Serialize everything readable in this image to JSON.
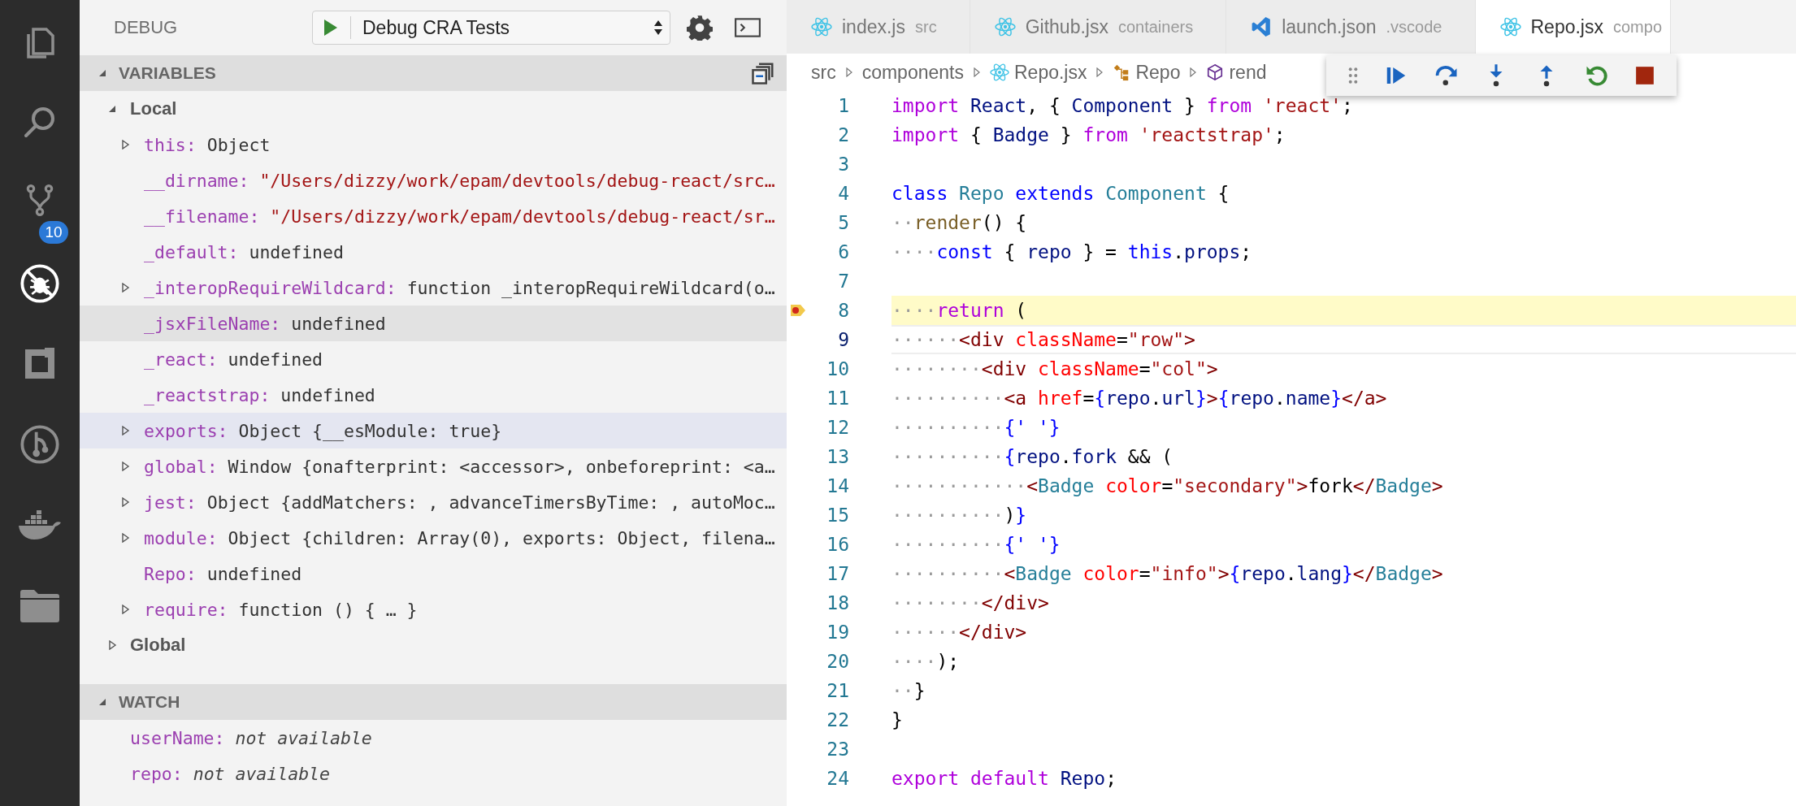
{
  "activity_bar": {
    "items": [
      {
        "kind": "files",
        "selected": false
      },
      {
        "kind": "search",
        "selected": false
      },
      {
        "kind": "source-control",
        "selected": false,
        "badge": "10"
      },
      {
        "kind": "debug",
        "selected": true
      },
      {
        "kind": "extensions",
        "selected": false
      },
      {
        "kind": "branch",
        "selected": false
      },
      {
        "kind": "docker",
        "selected": false
      },
      {
        "kind": "folder",
        "selected": false
      }
    ]
  },
  "debug_header": {
    "title": "DEBUG",
    "configuration": "Debug CRA Tests"
  },
  "variables": {
    "title": "VARIABLES",
    "expanded": true,
    "scopes": [
      {
        "label": "Local",
        "expanded": true,
        "children": [
          {
            "name": "this:",
            "value": "Object",
            "expandable": true,
            "kind": "plain",
            "selected": false,
            "hover": false
          },
          {
            "name": "__dirname:",
            "value": "\"/Users/dizzy/work/epam/devtools/debug-react/src…",
            "expandable": false,
            "kind": "string",
            "selected": false,
            "hover": false
          },
          {
            "name": "__filename:",
            "value": "\"/Users/dizzy/work/epam/devtools/debug-react/sr…",
            "expandable": false,
            "kind": "string",
            "selected": false,
            "hover": false
          },
          {
            "name": "_default:",
            "value": "undefined",
            "expandable": false,
            "kind": "plain",
            "selected": false,
            "hover": false
          },
          {
            "name": "_interopRequireWildcard:",
            "value": "function _interopRequireWildcard(o…",
            "expandable": true,
            "kind": "plain",
            "selected": false,
            "hover": false
          },
          {
            "name": "_jsxFileName:",
            "value": "undefined",
            "expandable": false,
            "kind": "plain",
            "selected": false,
            "hover": true
          },
          {
            "name": "_react:",
            "value": "undefined",
            "expandable": false,
            "kind": "plain",
            "selected": false,
            "hover": false
          },
          {
            "name": "_reactstrap:",
            "value": "undefined",
            "expandable": false,
            "kind": "plain",
            "selected": false,
            "hover": false
          },
          {
            "name": "exports:",
            "value": "Object {__esModule: true}",
            "expandable": true,
            "kind": "plain",
            "selected": true,
            "hover": false
          },
          {
            "name": "global:",
            "value": "Window {onafterprint: <accessor>, onbeforeprint: <a…",
            "expandable": true,
            "kind": "plain",
            "selected": false,
            "hover": false
          },
          {
            "name": "jest:",
            "value": "Object {addMatchers: , advanceTimersByTime: , autoMoc…",
            "expandable": true,
            "kind": "plain",
            "selected": false,
            "hover": false
          },
          {
            "name": "module:",
            "value": "Object {children: Array(0), exports: Object, filena…",
            "expandable": true,
            "kind": "plain",
            "selected": false,
            "hover": false
          },
          {
            "name": "Repo:",
            "value": "undefined",
            "expandable": false,
            "kind": "plain",
            "selected": false,
            "hover": false
          },
          {
            "name": "require:",
            "value": "function () { … }",
            "expandable": true,
            "kind": "plain",
            "selected": false,
            "hover": false
          }
        ]
      },
      {
        "label": "Global",
        "expanded": false
      }
    ]
  },
  "watch": {
    "title": "WATCH",
    "expanded": true,
    "items": [
      {
        "name": "userName:",
        "value": "not available"
      },
      {
        "name": "repo:",
        "value": "not available"
      }
    ]
  },
  "tabs": [
    {
      "label": "index.js",
      "description": "src",
      "kind": "react",
      "selected": false
    },
    {
      "label": "Github.jsx",
      "description": "containers",
      "kind": "react",
      "selected": false
    },
    {
      "label": "launch.json",
      "description": ".vscode",
      "kind": "vscode",
      "selected": false
    },
    {
      "label": "Repo.jsx",
      "description": "compo",
      "kind": "react",
      "selected": true
    }
  ],
  "breadcrumb": [
    {
      "label": "src",
      "kind": "folder"
    },
    {
      "label": "components",
      "kind": "folder"
    },
    {
      "label": "Repo.jsx",
      "kind": "react"
    },
    {
      "label": "Repo",
      "kind": "class"
    },
    {
      "label": "rend",
      "kind": "method"
    }
  ],
  "debug_toolbar": {
    "buttons": [
      {
        "kind": "grip"
      },
      {
        "kind": "continue"
      },
      {
        "kind": "step-over"
      },
      {
        "kind": "step-into"
      },
      {
        "kind": "step-out"
      },
      {
        "kind": "restart"
      },
      {
        "kind": "stop"
      }
    ]
  },
  "editor": {
    "lines": [
      {
        "number": "1",
        "paused": false,
        "cursor": false,
        "tokens": [
          {
            "kind": "kw",
            "text": "import"
          },
          {
            "kind": "var",
            "text": " React"
          },
          {
            "kind": "txt",
            "text": ", { "
          },
          {
            "kind": "var",
            "text": "Component"
          },
          {
            "kind": "txt",
            "text": " } "
          },
          {
            "kind": "kw",
            "text": "from"
          },
          {
            "kind": "str",
            "text": " 'react'"
          },
          {
            "kind": "txt",
            "text": ";"
          }
        ]
      },
      {
        "number": "2",
        "paused": false,
        "cursor": false,
        "tokens": [
          {
            "kind": "kw",
            "text": "import"
          },
          {
            "kind": "txt",
            "text": " { "
          },
          {
            "kind": "var",
            "text": "Badge"
          },
          {
            "kind": "txt",
            "text": " } "
          },
          {
            "kind": "kw",
            "text": "from"
          },
          {
            "kind": "str",
            "text": " 'reactstrap'"
          },
          {
            "kind": "txt",
            "text": ";"
          }
        ]
      },
      {
        "number": "3",
        "paused": false,
        "cursor": false
      },
      {
        "number": "4",
        "paused": false,
        "cursor": false,
        "tokens": [
          {
            "kind": "stor",
            "text": "class"
          },
          {
            "kind": "type",
            "text": " Repo"
          },
          {
            "kind": "stor",
            "text": " extends"
          },
          {
            "kind": "type",
            "text": " Component"
          },
          {
            "kind": "txt",
            "text": " {"
          }
        ]
      },
      {
        "number": "5",
        "paused": false,
        "cursor": false,
        "tokens": [
          {
            "kind": "ws",
            "text": "··"
          },
          {
            "kind": "fn",
            "text": "render"
          },
          {
            "kind": "txt",
            "text": "() {"
          }
        ]
      },
      {
        "number": "6",
        "paused": false,
        "cursor": false,
        "tokens": [
          {
            "kind": "ws",
            "text": "····"
          },
          {
            "kind": "stor",
            "text": "const"
          },
          {
            "kind": "txt",
            "text": " { "
          },
          {
            "kind": "var",
            "text": "repo"
          },
          {
            "kind": "txt",
            "text": " } = "
          },
          {
            "kind": "stor",
            "text": "this"
          },
          {
            "kind": "txt",
            "text": "."
          },
          {
            "kind": "var",
            "text": "props"
          },
          {
            "kind": "txt",
            "text": ";"
          }
        ]
      },
      {
        "number": "7",
        "paused": false,
        "cursor": false
      },
      {
        "number": "8",
        "paused": true,
        "cursor": false,
        "tokens": [
          {
            "kind": "ws",
            "text": "····"
          },
          {
            "kind": "kw",
            "text": "return"
          },
          {
            "kind": "txt",
            "text": " ("
          }
        ]
      },
      {
        "number": "9",
        "paused": false,
        "cursor": true,
        "tokens": [
          {
            "kind": "ws",
            "text": "······"
          },
          {
            "kind": "tag",
            "text": "<div"
          },
          {
            "kind": "attr",
            "text": " className"
          },
          {
            "kind": "txt",
            "text": "="
          },
          {
            "kind": "str",
            "text": "\"row\""
          },
          {
            "kind": "tag",
            "text": ">"
          }
        ]
      },
      {
        "number": "10",
        "paused": false,
        "cursor": false,
        "tokens": [
          {
            "kind": "ws",
            "text": "········"
          },
          {
            "kind": "tag",
            "text": "<div"
          },
          {
            "kind": "attr",
            "text": " className"
          },
          {
            "kind": "txt",
            "text": "="
          },
          {
            "kind": "str",
            "text": "\"col\""
          },
          {
            "kind": "tag",
            "text": ">"
          }
        ]
      },
      {
        "number": "11",
        "paused": false,
        "cursor": false,
        "tokens": [
          {
            "kind": "ws",
            "text": "··········"
          },
          {
            "kind": "tag",
            "text": "<a"
          },
          {
            "kind": "attr",
            "text": " href"
          },
          {
            "kind": "txt",
            "text": "="
          },
          {
            "kind": "stor",
            "text": "{"
          },
          {
            "kind": "var",
            "text": "repo"
          },
          {
            "kind": "txt",
            "text": "."
          },
          {
            "kind": "var",
            "text": "url"
          },
          {
            "kind": "stor",
            "text": "}"
          },
          {
            "kind": "tag",
            "text": ">"
          },
          {
            "kind": "stor",
            "text": "{"
          },
          {
            "kind": "var",
            "text": "repo"
          },
          {
            "kind": "txt",
            "text": "."
          },
          {
            "kind": "var",
            "text": "name"
          },
          {
            "kind": "stor",
            "text": "}"
          },
          {
            "kind": "tag",
            "text": "</a>"
          }
        ]
      },
      {
        "number": "12",
        "paused": false,
        "cursor": false,
        "tokens": [
          {
            "kind": "ws",
            "text": "··········"
          },
          {
            "kind": "stor",
            "text": "{' '}"
          }
        ]
      },
      {
        "number": "13",
        "paused": false,
        "cursor": false,
        "tokens": [
          {
            "kind": "ws",
            "text": "··········"
          },
          {
            "kind": "stor",
            "text": "{"
          },
          {
            "kind": "var",
            "text": "repo"
          },
          {
            "kind": "txt",
            "text": "."
          },
          {
            "kind": "var",
            "text": "fork"
          },
          {
            "kind": "txt",
            "text": " && ("
          }
        ]
      },
      {
        "number": "14",
        "paused": false,
        "cursor": false,
        "tokens": [
          {
            "kind": "ws",
            "text": "············"
          },
          {
            "kind": "tag",
            "text": "<"
          },
          {
            "kind": "type",
            "text": "Badge"
          },
          {
            "kind": "attr",
            "text": " color"
          },
          {
            "kind": "txt",
            "text": "="
          },
          {
            "kind": "str",
            "text": "\"secondary\""
          },
          {
            "kind": "tag",
            "text": ">"
          },
          {
            "kind": "txt",
            "text": "fork"
          },
          {
            "kind": "tag",
            "text": "</"
          },
          {
            "kind": "type",
            "text": "Badge"
          },
          {
            "kind": "tag",
            "text": ">"
          }
        ]
      },
      {
        "number": "15",
        "paused": false,
        "cursor": false,
        "tokens": [
          {
            "kind": "ws",
            "text": "··········"
          },
          {
            "kind": "txt",
            "text": ")"
          },
          {
            "kind": "stor",
            "text": "}"
          }
        ]
      },
      {
        "number": "16",
        "paused": false,
        "cursor": false,
        "tokens": [
          {
            "kind": "ws",
            "text": "··········"
          },
          {
            "kind": "stor",
            "text": "{' '}"
          }
        ]
      },
      {
        "number": "17",
        "paused": false,
        "cursor": false,
        "tokens": [
          {
            "kind": "ws",
            "text": "··········"
          },
          {
            "kind": "tag",
            "text": "<"
          },
          {
            "kind": "type",
            "text": "Badge"
          },
          {
            "kind": "attr",
            "text": " color"
          },
          {
            "kind": "txt",
            "text": "="
          },
          {
            "kind": "str",
            "text": "\"info\""
          },
          {
            "kind": "tag",
            "text": ">"
          },
          {
            "kind": "stor",
            "text": "{"
          },
          {
            "kind": "var",
            "text": "repo"
          },
          {
            "kind": "txt",
            "text": "."
          },
          {
            "kind": "var",
            "text": "lang"
          },
          {
            "kind": "stor",
            "text": "}"
          },
          {
            "kind": "tag",
            "text": "</"
          },
          {
            "kind": "type",
            "text": "Badge"
          },
          {
            "kind": "tag",
            "text": ">"
          }
        ]
      },
      {
        "number": "18",
        "paused": false,
        "cursor": false,
        "tokens": [
          {
            "kind": "ws",
            "text": "········"
          },
          {
            "kind": "tag",
            "text": "</div>"
          }
        ]
      },
      {
        "number": "19",
        "paused": false,
        "cursor": false,
        "tokens": [
          {
            "kind": "ws",
            "text": "······"
          },
          {
            "kind": "tag",
            "text": "</div>"
          }
        ]
      },
      {
        "number": "20",
        "paused": false,
        "cursor": false,
        "tokens": [
          {
            "kind": "ws",
            "text": "····"
          },
          {
            "kind": "txt",
            "text": ");"
          }
        ]
      },
      {
        "number": "21",
        "paused": false,
        "cursor": false,
        "tokens": [
          {
            "kind": "ws",
            "text": "··"
          },
          {
            "kind": "txt",
            "text": "}"
          }
        ]
      },
      {
        "number": "22",
        "paused": false,
        "cursor": false,
        "tokens": [
          {
            "kind": "txt",
            "text": "}"
          }
        ]
      },
      {
        "number": "23",
        "paused": false,
        "cursor": false
      },
      {
        "number": "24",
        "paused": false,
        "cursor": false,
        "tokens": [
          {
            "kind": "kw",
            "text": "export"
          },
          {
            "kind": "kw",
            "text": " default"
          },
          {
            "kind": "var",
            "text": " Repo"
          },
          {
            "kind": "txt",
            "text": ";"
          }
        ]
      }
    ]
  }
}
